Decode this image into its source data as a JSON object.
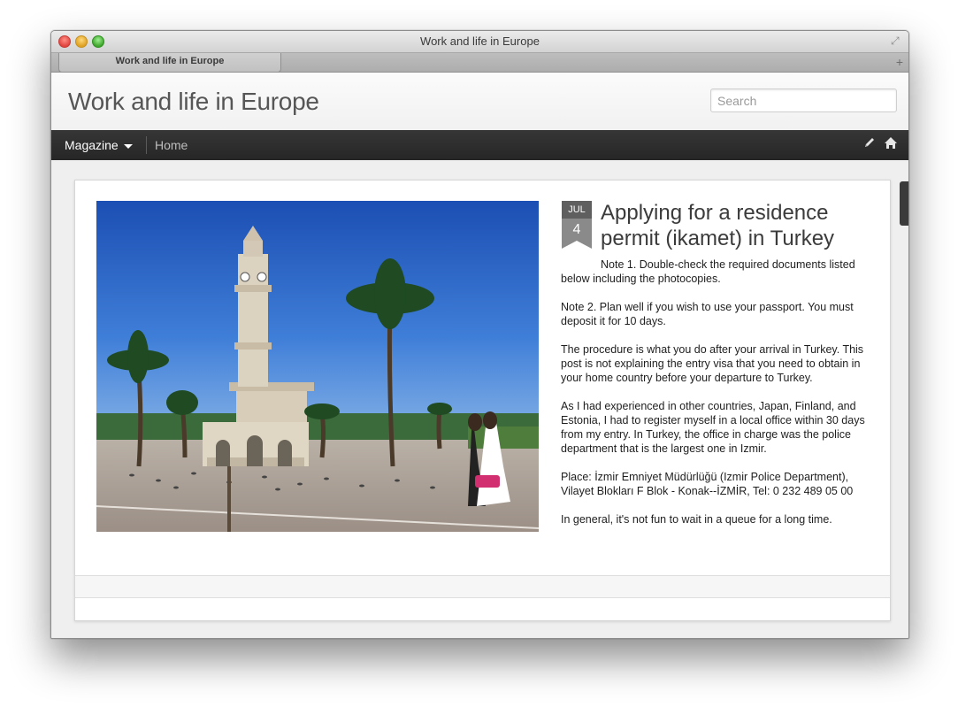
{
  "window": {
    "title": "Work and life in Europe"
  },
  "tabs": [
    {
      "label": "Work and life in Europe"
    }
  ],
  "header": {
    "site_title": "Work and life in Europe",
    "search_placeholder": "Search"
  },
  "nav": {
    "magazine_label": "Magazine",
    "home_label": "Home",
    "icons": [
      "pencil-icon",
      "home-icon"
    ]
  },
  "post": {
    "date_month": "JUL",
    "date_day": "4",
    "title": "Applying for a residence permit (ikamet) in Turkey",
    "paragraphs": [
      "Note 1. Double-check the required documents listed below including the photocopies.",
      "Note 2. Plan well if you wish to use your passport. You must deposit it for 10 days.",
      "The procedure is what you do after your arrival in Turkey. This post is not explaining the entry visa that you need to obtain in your home country before your departure to Turkey.",
      "As I had experienced in other countries, Japan, Finland, and Estonia, I had to register myself in a local office within 30 days from my entry. In Turkey, the office in charge was the police department that is the largest one in Izmir.",
      "Place: İzmir Emniyet Müdürlüğü (Izmir Police Department), Vilayet Blokları F Blok - Konak--İZMİR, Tel: 0 232 489 05 00",
      "In general, it's not fun to wait in a queue for a long time."
    ]
  },
  "colors": {
    "navbar": "#2e2e2e",
    "title_text": "#565656",
    "date_badge": "#5f5f5f"
  }
}
